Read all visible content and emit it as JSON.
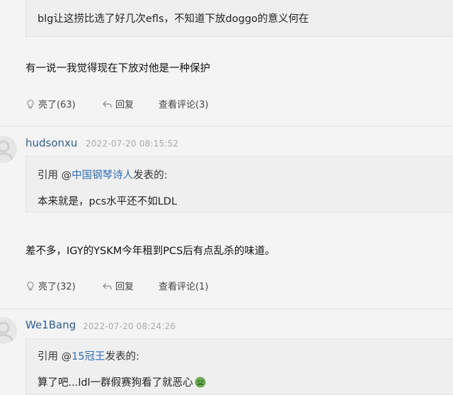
{
  "comment1": {
    "quote_text": "blg让这捞比选了好几次efls，不知道下放doggo的意义何在",
    "body": "有一说一我觉得现在下放对他是一种保护",
    "actions": {
      "like": "亮了(63)",
      "reply": "回复",
      "view": "查看评论(3)"
    }
  },
  "comment2": {
    "username": "hudsonxu",
    "timestamp": "2022-07-20 08:15:52",
    "quote": {
      "prefix": "引用 @",
      "mention": "中国钢琴诗人",
      "suffix": "发表的:",
      "text": "本来就是，pcs水平还不如LDL"
    },
    "body": "差不多，IGY的YSKM今年租到PCS后有点乱杀的味道。",
    "actions": {
      "like": "亮了(32)",
      "reply": "回复",
      "view": "查看评论(1)"
    }
  },
  "comment3": {
    "username": "We1Bang",
    "timestamp": "2022-07-20 08:24:26",
    "quote": {
      "prefix": "引用 @",
      "mention": "15冠王",
      "suffix": "发表的:",
      "text": "算了吧...ldl一群假赛狗看了就恶心"
    }
  }
}
